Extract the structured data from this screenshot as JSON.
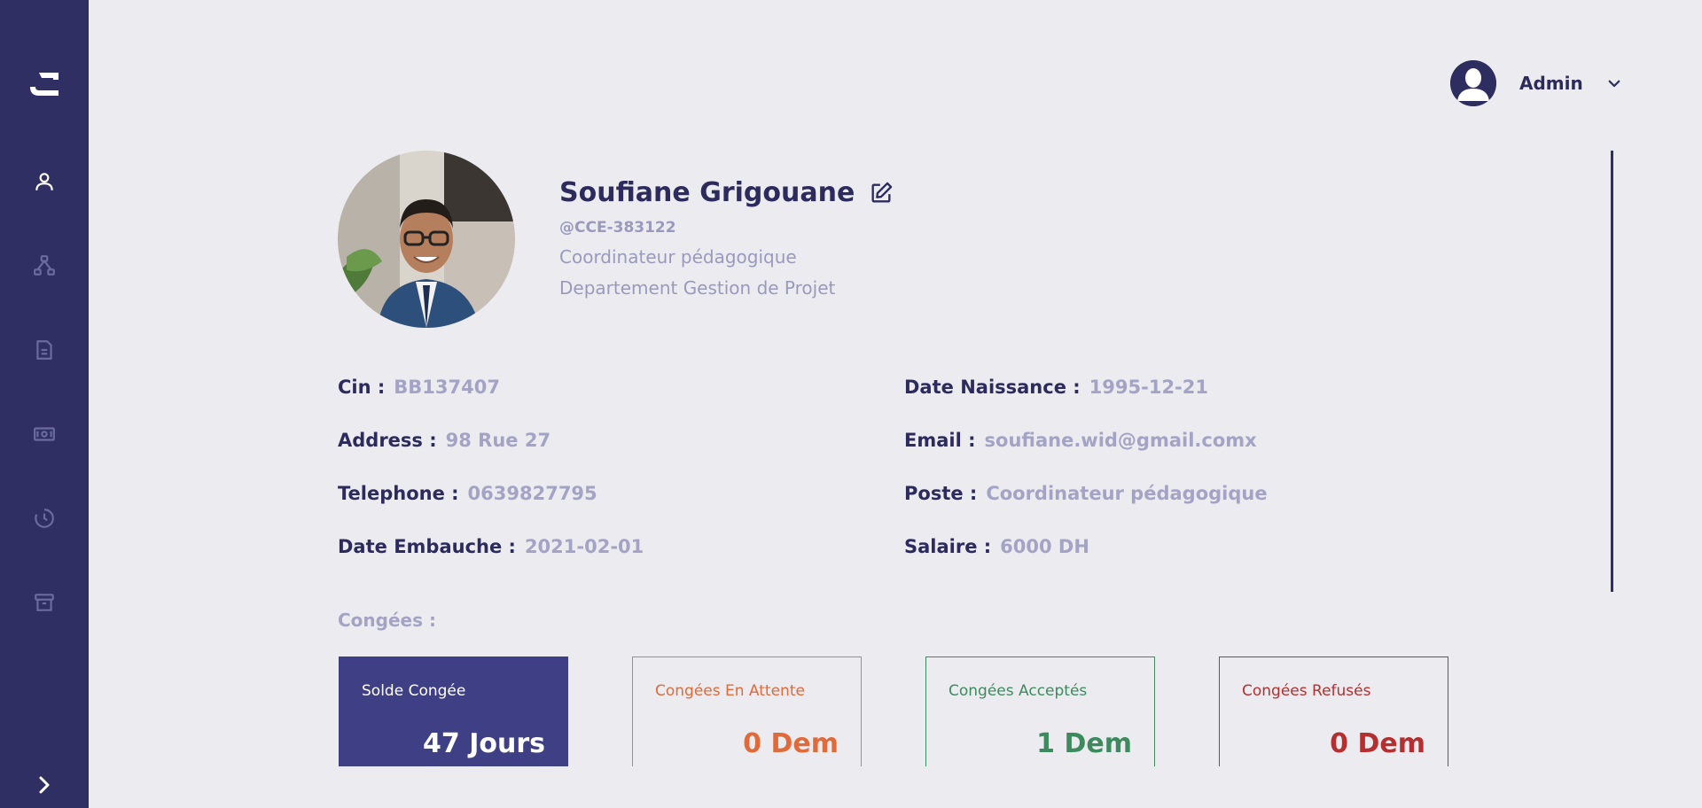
{
  "sidebar": {
    "items": [
      {
        "icon": "user-icon",
        "active": true
      },
      {
        "icon": "org-chart-icon",
        "active": false
      },
      {
        "icon": "document-icon",
        "active": false
      },
      {
        "icon": "money-icon",
        "active": false
      },
      {
        "icon": "clock-icon",
        "active": false
      },
      {
        "icon": "archive-icon",
        "active": false
      }
    ],
    "expand_icon": "chevron-right-icon"
  },
  "user_menu": {
    "name": "Admin"
  },
  "profile": {
    "name": "Soufiane Grigouane",
    "handle": "@CCE-383122",
    "role": "Coordinateur pédagogique",
    "department": "Departement Gestion de Projet"
  },
  "fields": {
    "cin": {
      "label": "Cin :",
      "value": "BB137407"
    },
    "address": {
      "label": "Address :",
      "value": "98 Rue 27"
    },
    "telephone": {
      "label": "Telephone :",
      "value": "0639827795"
    },
    "date_embauche": {
      "label": "Date Embauche :",
      "value": "2021-02-01"
    },
    "date_naissance": {
      "label": "Date Naissance :",
      "value": "1995-12-21"
    },
    "email": {
      "label": "Email :",
      "value": "soufiane.wid@gmail.comx"
    },
    "poste": {
      "label": "Poste :",
      "value": "Coordinateur pédagogique"
    },
    "salaire": {
      "label": "Salaire :",
      "value": "6000 DH"
    }
  },
  "conges": {
    "title": "Congées :",
    "cards": {
      "solde": {
        "title": "Solde Congée",
        "value": "47 Jours"
      },
      "attente": {
        "title": "Congées En Attente",
        "value": "0 Dem"
      },
      "acceptes": {
        "title": "Congées Acceptés",
        "value": "1 Dem"
      },
      "refuses": {
        "title": "Congées Refusés",
        "value": "0 Dem"
      }
    }
  },
  "colors": {
    "sidebar": "#302f63",
    "background": "#ececf0",
    "primary_text": "#2d2b5e",
    "muted_text": "#a4a3c6",
    "pending": "#e06a3a",
    "accepted": "#3d8a5e",
    "refused": "#b42f2f"
  }
}
